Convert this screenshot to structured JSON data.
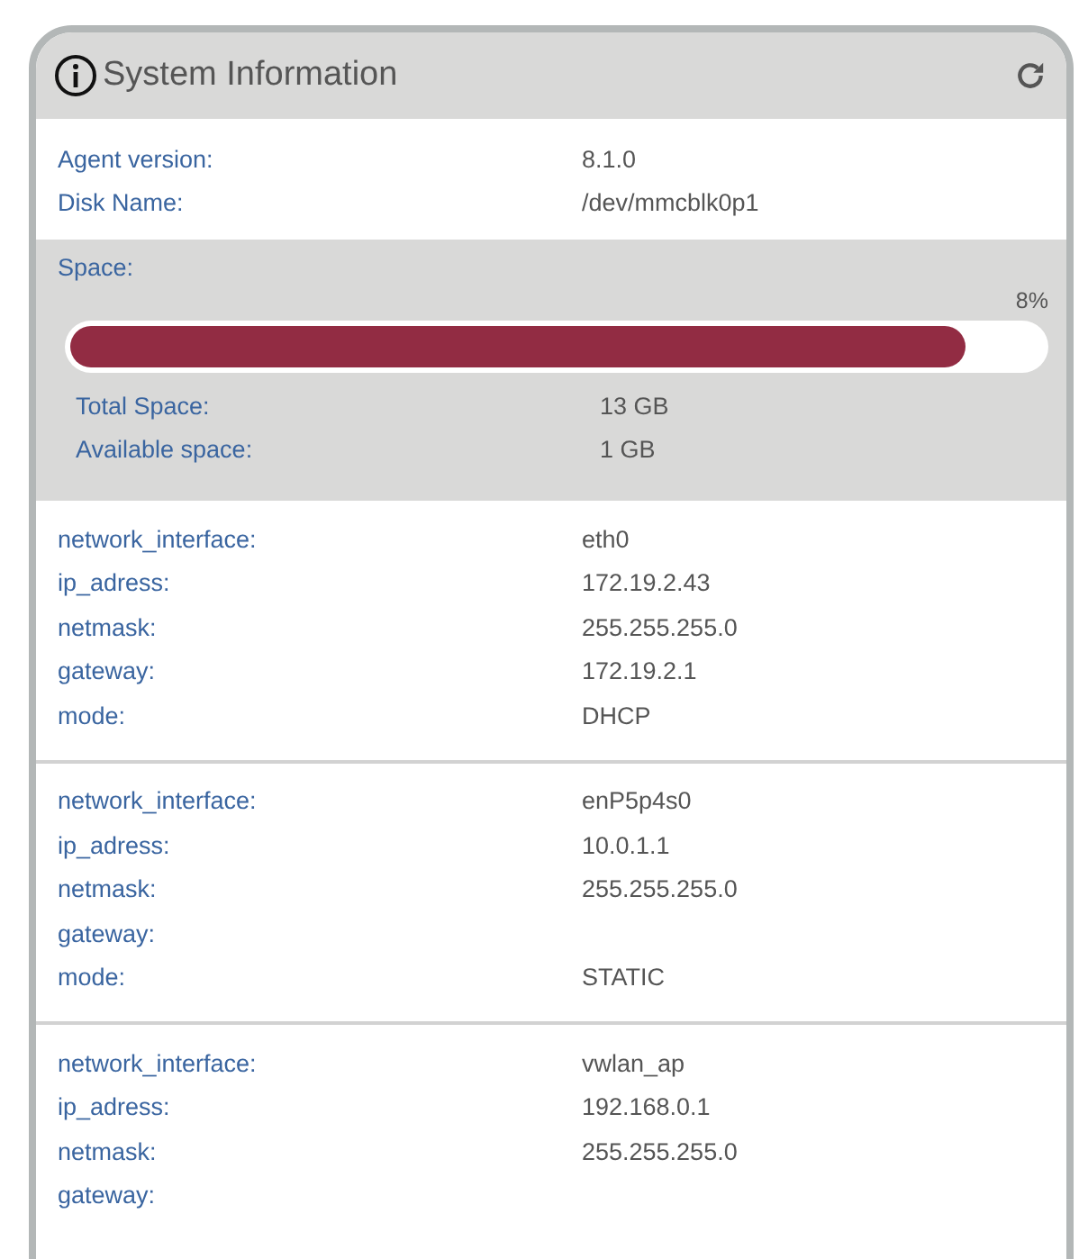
{
  "panel": {
    "title": "System Information"
  },
  "info": [
    {
      "label": "Agent version:",
      "value": "8.1.0"
    },
    {
      "label": "Disk Name:",
      "value": "/dev/mmcblk0p1"
    }
  ],
  "space": {
    "label": "Space:",
    "percent": "8%",
    "level": 0.92,
    "rows": [
      {
        "label": "Total Space:",
        "value": "13 GB"
      },
      {
        "label": "Available space:",
        "value": "1 GB"
      }
    ]
  },
  "interfaces": [
    {
      "rows": [
        {
          "label": "network_interface:",
          "value": "eth0"
        },
        {
          "label": "ip_adress:",
          "value": "172.19.2.43"
        },
        {
          "label": "netmask:",
          "value": "255.255.255.0"
        },
        {
          "label": "gateway:",
          "value": "172.19.2.1"
        },
        {
          "label": "mode:",
          "value": "DHCP"
        }
      ]
    },
    {
      "rows": [
        {
          "label": "network_interface:",
          "value": "enP5p4s0"
        },
        {
          "label": "ip_adress:",
          "value": "10.0.1.1"
        },
        {
          "label": "netmask:",
          "value": "255.255.255.0"
        },
        {
          "label": "gateway:"
        },
        {
          "label": "mode:",
          "value": "STATIC"
        }
      ]
    },
    {
      "rows": [
        {
          "label": "network_interface:",
          "value": "vwlan_ap"
        },
        {
          "label": "ip_adress:",
          "value": "192.168.0.1"
        },
        {
          "label": "netmask:",
          "value": "255.255.255.0"
        },
        {
          "label": "gateway:"
        }
      ]
    }
  ]
}
